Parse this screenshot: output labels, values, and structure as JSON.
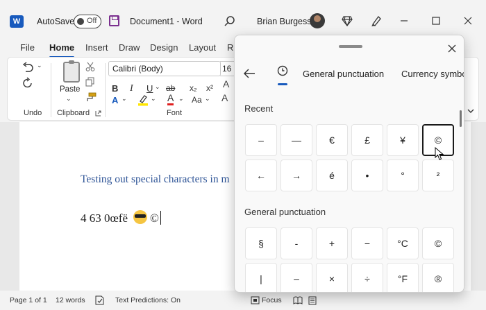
{
  "app": {
    "autosave_label": "AutoSave",
    "autosave_state": "Off",
    "document_title": "Document1  -  Word",
    "user_name": "Brian Burgess"
  },
  "ribbon": {
    "tabs": [
      "File",
      "Home",
      "Insert",
      "Draw",
      "Design",
      "Layout",
      "Re"
    ],
    "active_tab": "Home",
    "groups": {
      "undo": "Undo",
      "clipboard": "Clipboard",
      "font": "Font"
    },
    "paste_label": "Paste",
    "font_name": "Calibri (Body)",
    "font_size": "16",
    "font_buttons": [
      "B",
      "I",
      "U",
      "ab",
      "x₂",
      "x²"
    ],
    "aa_label": "Aa"
  },
  "document": {
    "heading": "Testing out special characters in m",
    "line_text": "4 63   0œfë",
    "line_after_emoji": "©"
  },
  "statusbar": {
    "page": "Page 1 of 1",
    "words": "12 words",
    "text_predictions": "Text Predictions: On",
    "focus": "Focus"
  },
  "panel": {
    "tabs": [
      "General punctuation",
      "Currency symbo"
    ],
    "recent_title": "Recent",
    "recent": [
      "–",
      "—",
      "€",
      "£",
      "¥",
      "©",
      "←",
      "→",
      "é",
      "•",
      "°",
      "²"
    ],
    "selected_symbol": "©",
    "general_title": "General punctuation",
    "general": [
      "§",
      "-",
      "+",
      "−",
      "°C",
      "©",
      "|",
      "–",
      "×",
      "÷",
      "°F",
      "®"
    ]
  },
  "colors": {
    "accent": "#185abd",
    "heading_blue": "#2f5597",
    "highlight_yellow": "#ffe600",
    "font_color_red": "#e02020"
  }
}
